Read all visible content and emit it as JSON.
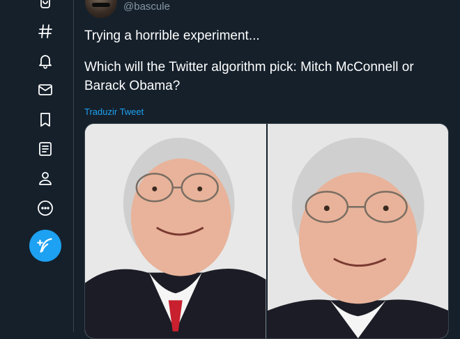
{
  "sidebar": {
    "icons": [
      {
        "name": "bookmark-bag-icon"
      },
      {
        "name": "explore-hashtag-icon"
      },
      {
        "name": "notifications-bell-icon"
      },
      {
        "name": "messages-envelope-icon"
      },
      {
        "name": "bookmarks-icon"
      },
      {
        "name": "lists-icon"
      },
      {
        "name": "profile-icon"
      },
      {
        "name": "more-icon"
      }
    ],
    "compose_icon": "compose-tweet-icon",
    "accent_color": "#1da1f2"
  },
  "tweet": {
    "handle": "@bascule",
    "text_line1": "Trying a horrible experiment...",
    "text_line2": "Which will the Twitter algorithm pick: Mitch McConnell or Barack Obama?",
    "translate_label": "Traduzir Tweet",
    "media": [
      {
        "description": "photo-left"
      },
      {
        "description": "photo-right"
      }
    ]
  },
  "theme": {
    "background": "#15202b",
    "border": "#38444d",
    "secondary_text": "#8899a6"
  }
}
